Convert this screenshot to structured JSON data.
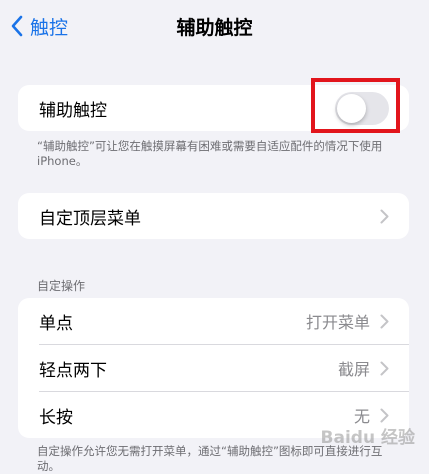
{
  "nav": {
    "back_label": "触控",
    "title": "辅助触控"
  },
  "assistive": {
    "label": "辅助触控",
    "toggle_on": false,
    "footnote": "“辅助触控”可让您在触摸屏幕有困难或需要自适应配件的情况下使用iPhone。"
  },
  "top_menu": {
    "label": "自定顶层菜单"
  },
  "custom_actions": {
    "header": "自定操作",
    "rows": [
      {
        "label": "单点",
        "value": "打开菜单"
      },
      {
        "label": "轻点两下",
        "value": "截屏"
      },
      {
        "label": "长按",
        "value": "无"
      }
    ],
    "footnote": "自定操作允许您无需打开菜单，通过“辅助触控”图标即可直接进行互动。"
  },
  "watermark": "Baidu 经验",
  "colors": {
    "accent": "#1a73e8",
    "highlight": "#e2151c",
    "toggle_off": "#e5e5ea"
  }
}
